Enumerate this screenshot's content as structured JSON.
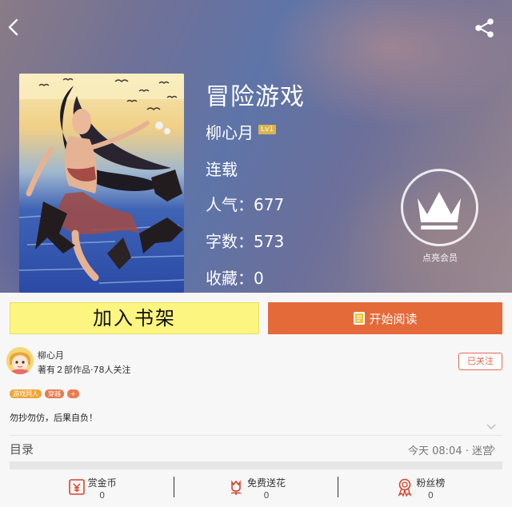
{
  "book": {
    "title": "冒险游戏",
    "author": "柳心月",
    "author_level": "Lv1",
    "status": "连载",
    "popularity_label": "人气：",
    "popularity": "677",
    "word_count_label": "字数：",
    "word_count": "573",
    "favorites_label": "收藏：",
    "favorites": "0"
  },
  "vip": {
    "label": "点亮会员"
  },
  "actions": {
    "add_shelf": "加入书架",
    "start_reading": "开始阅读"
  },
  "author_card": {
    "name": "柳心月",
    "stats": "著有２部作品·78人关注",
    "follow_label": "已关注"
  },
  "tags": [
    {
      "label": "游戏同人",
      "color": "#eea63a"
    },
    {
      "label": "穿越",
      "color": "#e57a4e"
    },
    {
      "label": "+",
      "color": "#ec7b55"
    }
  ],
  "notice": "勿抄勿仿，后果自负！",
  "toc": {
    "title": "目录",
    "update": "今天 08:04 · 迷宫"
  },
  "stats": [
    {
      "label": "赏金币",
      "value": "0",
      "icon": "gold-coin-icon"
    },
    {
      "label": "免费送花",
      "value": "0",
      "icon": "flower-icon"
    },
    {
      "label": "粉丝榜",
      "value": "0",
      "icon": "medal-icon"
    }
  ],
  "colors": {
    "accent": "#e56a39",
    "shelf_button": "#fcf580",
    "follow": "#e46a53"
  }
}
